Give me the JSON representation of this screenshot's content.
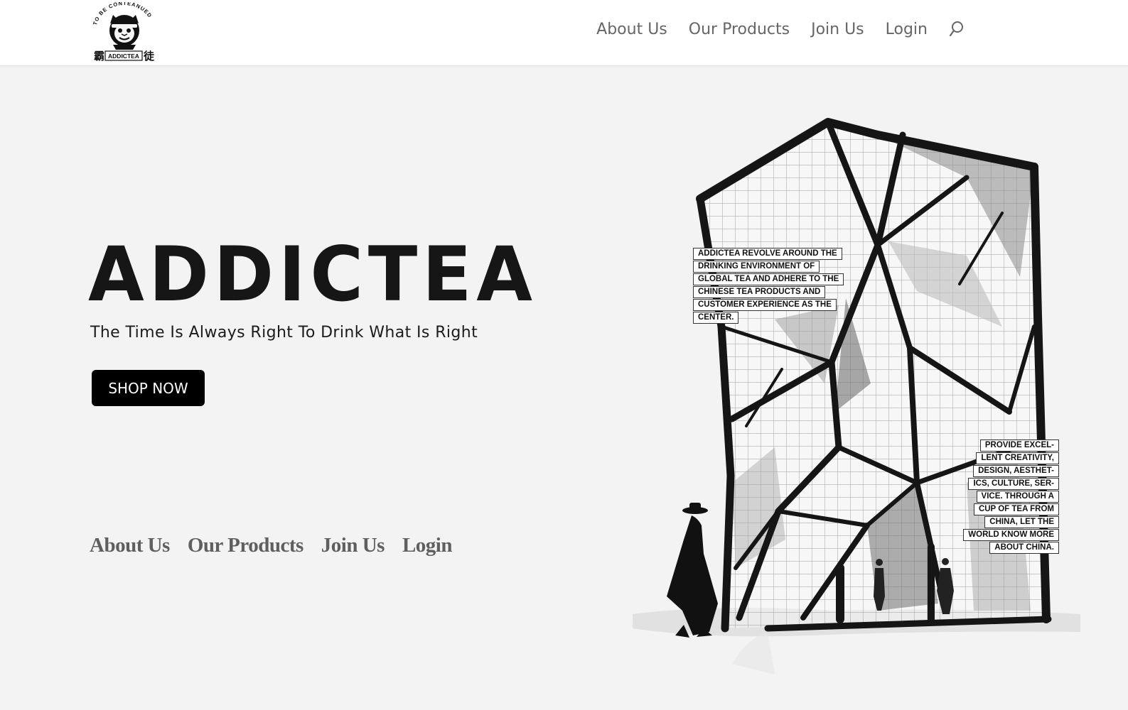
{
  "header": {
    "logo": {
      "top_text": "TO BE CONTEANUED",
      "wordmark": "ADDICTEA",
      "left_char": "霸",
      "right_char": "徒"
    },
    "nav": [
      "About Us",
      "Our Products",
      "Join Us",
      "Login"
    ],
    "search_icon": "search-icon"
  },
  "hero": {
    "title": "ADDICTEA",
    "tagline": "The Time Is Always Right To Drink What Is Right",
    "cta_label": "SHOP NOW"
  },
  "footer_nav": [
    "About Us",
    "Our Products",
    "Join Us",
    "Login"
  ],
  "illustration": {
    "callout_1": [
      "ADDICTEA REVOLVE AROUND THE",
      "DRINKING ENVIRONMENT OF",
      "GLOBAL TEA AND ADHERE TO THE",
      "CHINESE TEA PRODUCTS AND",
      "CUSTOMER EXPERIENCE AS THE",
      "CENTER."
    ],
    "callout_2": [
      "PROVIDE EXCEL-",
      "LENT CREATIVITY,",
      "DESIGN, AESTHET-",
      "ICS, CULTURE, SER-",
      "VICE. THROUGH A",
      "CUP OF TEA FROM",
      "CHINA, LET THE",
      "WORLD KNOW MORE",
      "ABOUT CHINA."
    ]
  },
  "colors": {
    "background": "#f3f3f3",
    "header_bg": "#ffffff",
    "nav_text": "#666666",
    "title_text": "#161616",
    "button_bg": "#000000",
    "button_text": "#ffffff",
    "footer_nav_text": "#5f5f5f"
  }
}
